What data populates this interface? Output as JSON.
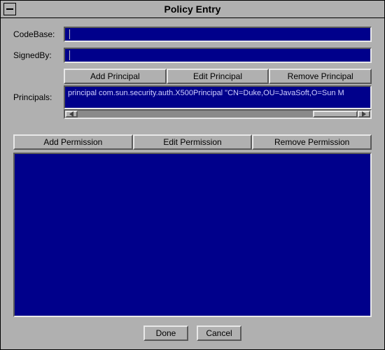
{
  "window": {
    "title": "Policy Entry"
  },
  "fields": {
    "codebase_label": "CodeBase:",
    "codebase_value": "",
    "signedby_label": "SignedBy:",
    "signedby_value": ""
  },
  "principal_buttons": {
    "add": "Add Principal",
    "edit": "Edit Principal",
    "remove": "Remove Principal"
  },
  "principals": {
    "label": "Principals:",
    "entries": [
      "principal com.sun.security.auth.X500Principal \"CN=Duke,OU=JavaSoft,O=Sun M"
    ]
  },
  "permission_buttons": {
    "add": "Add Permission",
    "edit": "Edit Permission",
    "remove": "Remove Permission"
  },
  "permissions": {
    "entries": []
  },
  "footer": {
    "done": "Done",
    "cancel": "Cancel"
  }
}
